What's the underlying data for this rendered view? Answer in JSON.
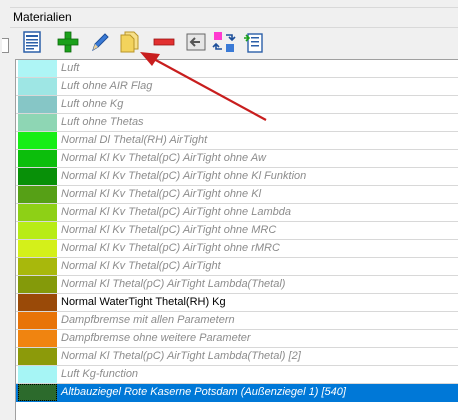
{
  "panel": {
    "title": "Materialien"
  },
  "toolbar": {
    "buttons": [
      {
        "icon": "document-list-icon"
      },
      {
        "icon": "add-icon",
        "color": "#1aa01a"
      },
      {
        "icon": "edit-icon",
        "color": "#2a6fcf"
      },
      {
        "icon": "copy-icon",
        "color": "#f0c040"
      },
      {
        "icon": "remove-icon",
        "color": "#e23030"
      },
      {
        "icon": "import-icon"
      },
      {
        "icon": "sort-icon"
      },
      {
        "icon": "export-icon"
      }
    ]
  },
  "annotation": {
    "arrow_color": "#c81e1e"
  },
  "materials": [
    {
      "label": "Luft",
      "color": "#aef5f5",
      "style": "italic"
    },
    {
      "label": "Luft ohne AIR Flag",
      "color": "#9ee6e4",
      "style": "italic"
    },
    {
      "label": "Luft ohne Kg",
      "color": "#86c6c6",
      "style": "italic"
    },
    {
      "label": "Luft ohne Thetas",
      "color": "#8ed6b4",
      "style": "italic"
    },
    {
      "label": "Normal Dl  Thetal(RH) AirTight",
      "color": "#16ee16",
      "style": "italic"
    },
    {
      "label": "Normal Kl Kv Thetal(pC) AirTight ohne Aw",
      "color": "#0cbe0c",
      "style": "italic"
    },
    {
      "label": "Normal Kl Kv Thetal(pC) AirTight ohne Kl Funktion",
      "color": "#089008",
      "style": "italic"
    },
    {
      "label": "Normal Kl Kv Thetal(pC) AirTight ohne Kl",
      "color": "#56a016",
      "style": "italic"
    },
    {
      "label": "Normal Kl Kv Thetal(pC) AirTight ohne Lambda",
      "color": "#8ed016",
      "style": "italic"
    },
    {
      "label": "Normal Kl Kv Thetal(pC) AirTight ohne MRC",
      "color": "#b8ec16",
      "style": "italic"
    },
    {
      "label": "Normal Kl Kv Thetal(pC) AirTight ohne rMRC",
      "color": "#d4f01a",
      "style": "italic"
    },
    {
      "label": "Normal Kl Kv Thetal(pC) AirTight",
      "color": "#a8b80c",
      "style": "italic"
    },
    {
      "label": "Normal Kl Thetal(pC) AirTight Lambda(Thetal)",
      "color": "#849a0a",
      "style": "italic"
    },
    {
      "label": "Normal WaterTight Thetal(RH) Kg",
      "color": "#9a4a08",
      "style": "bold"
    },
    {
      "label": "Dampfbremse mit allen Parametern",
      "color": "#e87408",
      "style": "italic"
    },
    {
      "label": "Dampfbremse ohne weitere Parameter",
      "color": "#f08410",
      "style": "italic"
    },
    {
      "label": "Normal Kl Thetal(pC) AirTight Lambda(Thetal) [2]",
      "color": "#8c9a0a",
      "style": "italic"
    },
    {
      "label": "Luft Kg-function",
      "color": "#a6f5f5",
      "style": "italic"
    },
    {
      "label": "Altbauziegel Rote Kaserne Potsdam (Außenziegel 1) [540]",
      "color": "#2c6a2c",
      "style": "italic",
      "selected": true
    }
  ]
}
